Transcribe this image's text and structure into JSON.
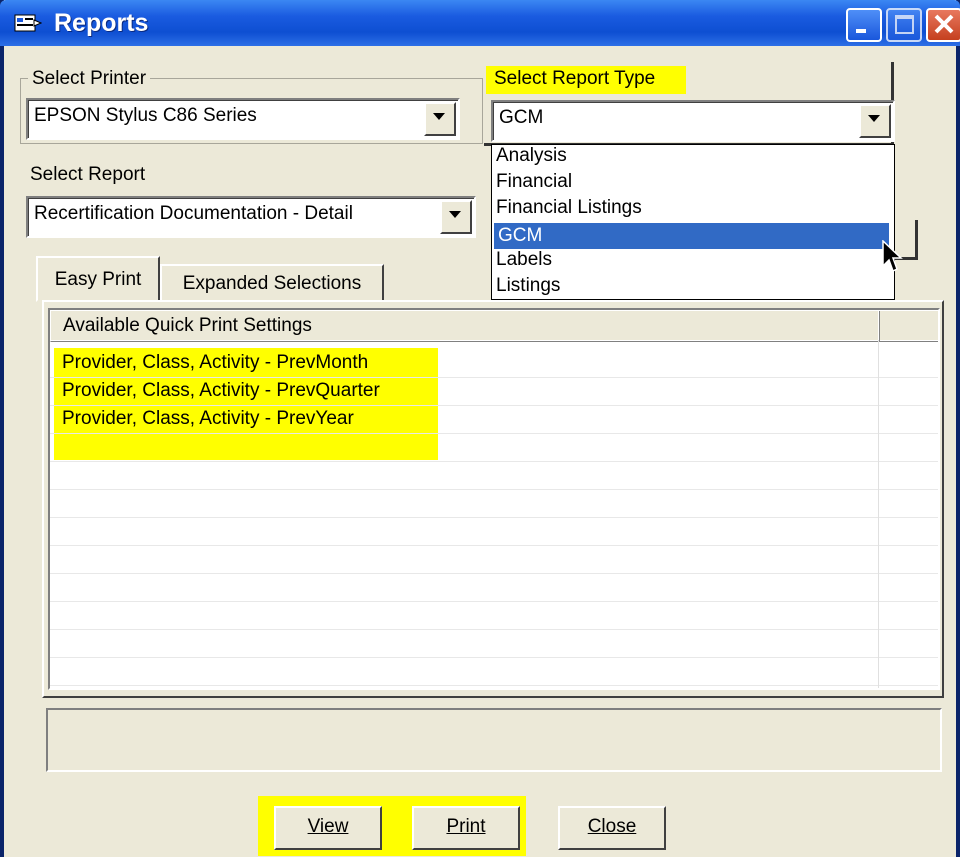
{
  "window": {
    "title": "Reports",
    "icon": "reports-app-icon"
  },
  "printer": {
    "group_label": "Select Printer",
    "selected": "EPSON Stylus C86 Series"
  },
  "report_type": {
    "label": "Select Report Type",
    "selected": "GCM",
    "options": [
      "Analysis",
      "Financial",
      "Financial Listings",
      "GCM",
      "Labels",
      "Listings"
    ],
    "highlighted": "GCM"
  },
  "report": {
    "label": "Select Report",
    "selected": "Recertification Documentation - Detail"
  },
  "tabs": [
    {
      "label": "Easy Print",
      "active": true
    },
    {
      "label": "Expanded Selections",
      "active": false
    }
  ],
  "quick_print": {
    "header": "Available Quick Print Settings",
    "items": [
      "Provider, Class, Activity - PrevMonth",
      "Provider, Class, Activity - PrevQuarter",
      "Provider, Class, Activity - PrevYear"
    ]
  },
  "buttons": {
    "view": "View",
    "print": "Print",
    "close": "Close"
  },
  "colors": {
    "highlight": "#ffff00",
    "selection": "#316ac5",
    "titlebar": "#0e4fd2"
  }
}
